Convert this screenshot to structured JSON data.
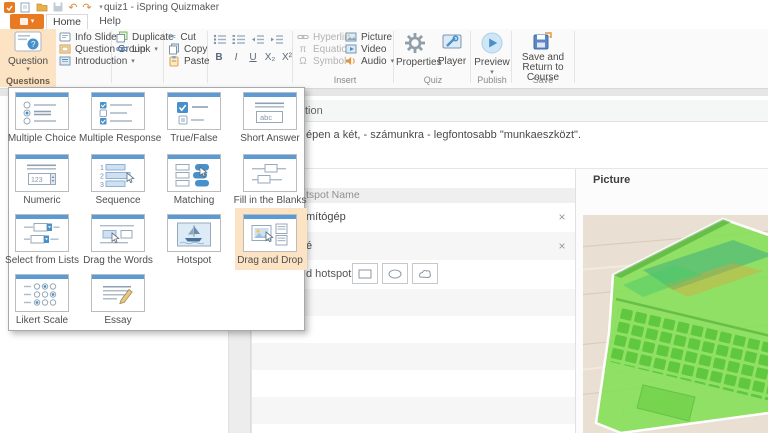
{
  "titlebar": {
    "title": "quiz1 - iSpring Quizmaker"
  },
  "tabs": {
    "home": "Home",
    "help": "Help"
  },
  "icons": {
    "chevron_down": "▾",
    "close": "×",
    "cut": "✂",
    "undo": "↶",
    "redo": "↷",
    "equation": "π",
    "symbol": "Ω"
  },
  "ribbon": {
    "question": {
      "label": "Question",
      "group_label": "Questions"
    },
    "slides": {
      "items": [
        "Info Slide",
        "Question Group",
        "Introduction"
      ]
    },
    "edit": {
      "items": [
        "Duplicate",
        "Link"
      ]
    },
    "clipboard": {
      "items": [
        "Cut",
        "Copy",
        "Paste"
      ]
    },
    "format": {
      "bold": "B",
      "italic": "I",
      "underline": "U",
      "subscript": "X₂",
      "superscript": "X²"
    },
    "insert": {
      "label": "Insert",
      "items": [
        "Hyperlink",
        "Equation",
        "Symbol",
        "Picture",
        "Video",
        "Audio"
      ]
    },
    "quiz": {
      "label": "Quiz",
      "properties": "Properties",
      "player": "Player"
    },
    "publish": {
      "label": "Publish",
      "preview": "Preview"
    },
    "save": {
      "label": "Save",
      "save_return": "Save and Return to Course"
    }
  },
  "questions_menu": {
    "highlighted_index": 11,
    "items": [
      {
        "label": "Multiple Choice",
        "type": "mc"
      },
      {
        "label": "Multiple Response",
        "type": "mr"
      },
      {
        "label": "True/False",
        "type": "tf"
      },
      {
        "label": "Short Answer",
        "type": "sa"
      },
      {
        "label": "Numeric",
        "type": "num"
      },
      {
        "label": "Sequence",
        "type": "seq"
      },
      {
        "label": "Matching",
        "type": "match"
      },
      {
        "label": "Fill in the Blanks",
        "type": "fib"
      },
      {
        "label": "Select from Lists",
        "type": "sel"
      },
      {
        "label": "Drag the Words",
        "type": "dw"
      },
      {
        "label": "Hotspot",
        "type": "hot"
      },
      {
        "label": "Drag and Drop",
        "type": "dnd"
      },
      {
        "label": "Likert Scale",
        "type": "likert"
      },
      {
        "label": "Essay",
        "type": "essay"
      }
    ]
  },
  "content": {
    "question": {
      "header_fragment": "tion",
      "text_fragment": "épen a két, - számunkra - legfontosabb \"munkaeszközt\"."
    },
    "hotspot": {
      "header_fragment": "tspot Name",
      "rows": [
        {
          "name_fragment": "mítógép"
        },
        {
          "name_fragment": "é"
        }
      ],
      "add_fragment": "d hotspot:"
    },
    "picture": {
      "title": "Picture"
    }
  },
  "colors": {
    "accent_orange": "#e87a22",
    "highlight_tan": "#fbe3c4",
    "tile_header_blue": "#5b9bd5",
    "hotspot_green": "#87e05a"
  }
}
